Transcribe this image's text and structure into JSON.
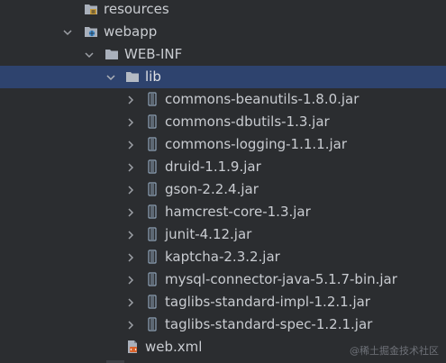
{
  "tree": {
    "resources": {
      "label": "resources",
      "icon": "resources-folder-icon"
    },
    "webapp": {
      "label": "webapp",
      "icon": "web-folder-icon"
    },
    "web_inf": {
      "label": "WEB-INF",
      "icon": "folder-icon"
    },
    "lib": {
      "label": "lib",
      "icon": "folder-icon"
    },
    "jars": [
      {
        "label": "commons-beanutils-1.8.0.jar"
      },
      {
        "label": "commons-dbutils-1.3.jar"
      },
      {
        "label": "commons-logging-1.1.1.jar"
      },
      {
        "label": "druid-1.1.9.jar"
      },
      {
        "label": "gson-2.2.4.jar"
      },
      {
        "label": "hamcrest-core-1.3.jar"
      },
      {
        "label": "junit-4.12.jar"
      },
      {
        "label": "kaptcha-2.3.2.jar"
      },
      {
        "label": "mysql-connector-java-5.1.7-bin.jar"
      },
      {
        "label": "taglibs-standard-impl-1.2.1.jar"
      },
      {
        "label": "taglibs-standard-spec-1.2.1.jar"
      }
    ],
    "web_xml": {
      "label": "web.xml",
      "icon": "xml-file-icon"
    }
  },
  "watermark": "@稀土掘金技术社区",
  "colors": {
    "background": "#2b2d30",
    "selection": "#2e436e",
    "text": "#c9ccd1",
    "folder": "#a9b0bb",
    "jar": "#8fa4b8"
  }
}
